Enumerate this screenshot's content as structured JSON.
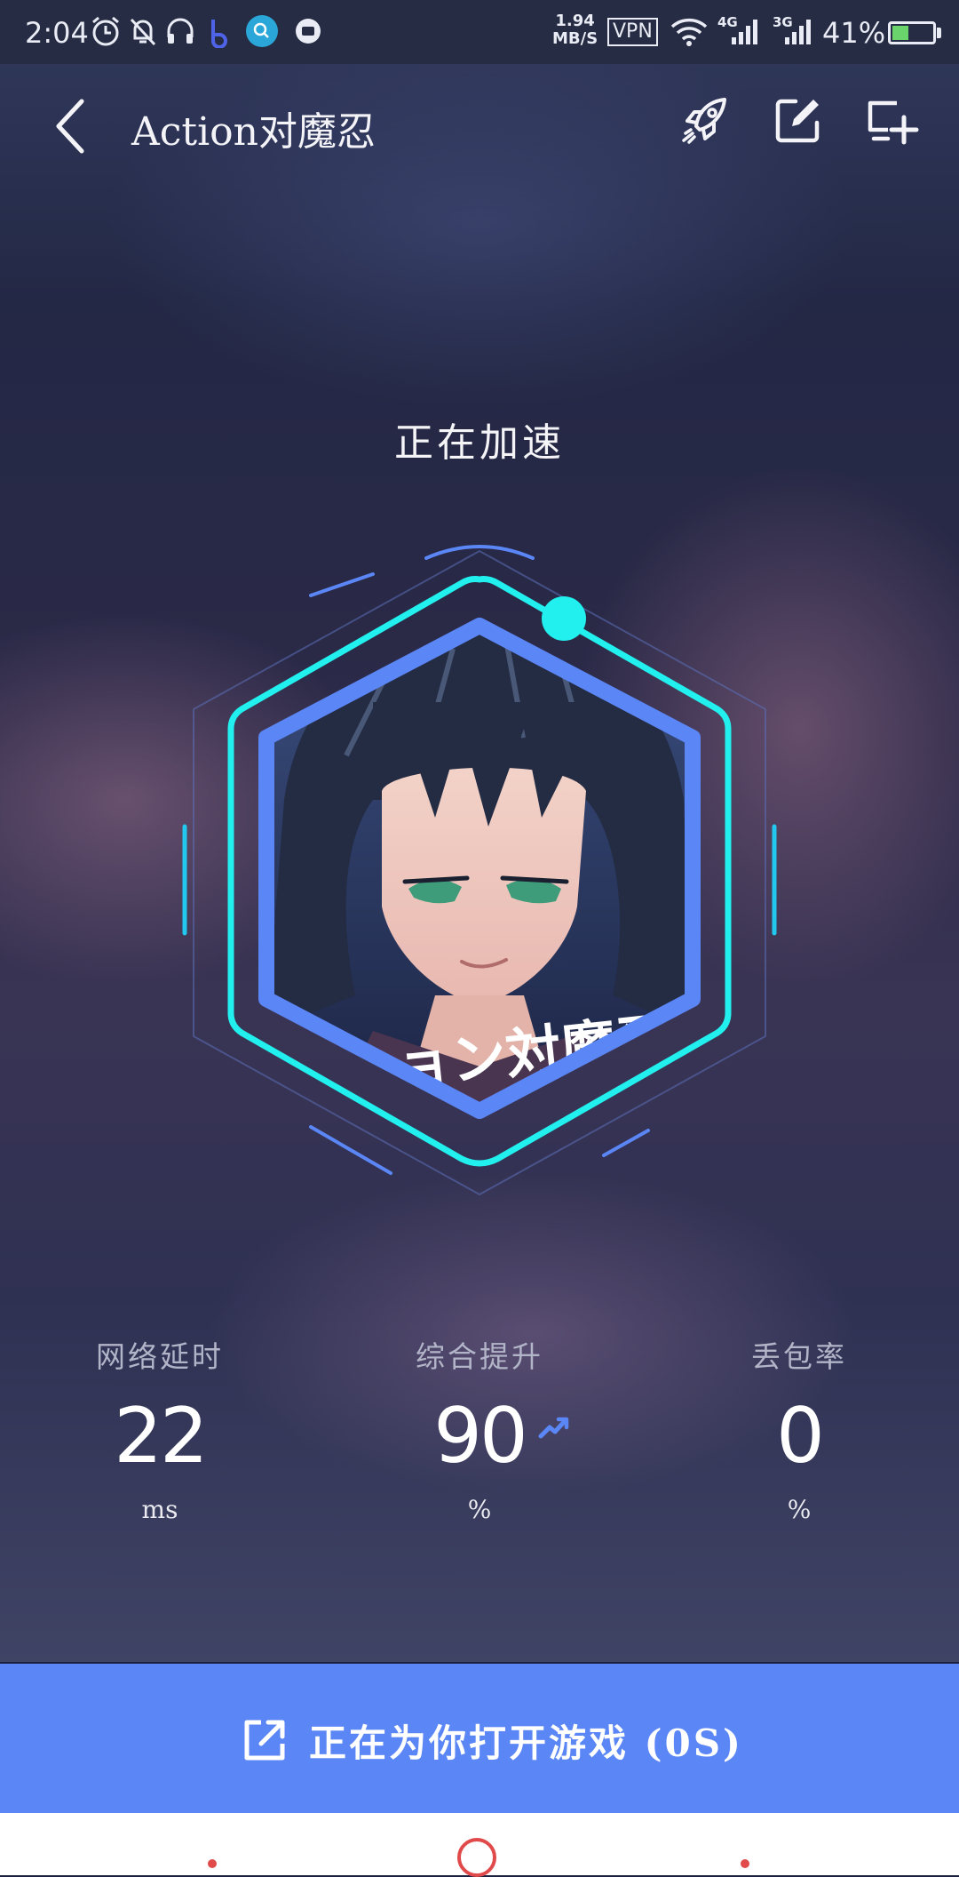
{
  "status_bar": {
    "time": "2:04",
    "net_speed_value": "1.94",
    "net_speed_unit": "MB/S",
    "vpn_label": "VPN",
    "signal1_label": "4G",
    "signal2_label": "3G",
    "battery_percent": "41%",
    "battery_level": 0.41,
    "icons": [
      "alarm-icon",
      "mute-bell-icon",
      "headphones-icon",
      "app-b-icon",
      "search-app-icon",
      "message-app-icon",
      "wifi-icon",
      "signal-icon"
    ]
  },
  "app_bar": {
    "title": "Action对魔忍",
    "actions": [
      "rocket-icon",
      "edit-icon",
      "add-to-desktop-icon"
    ]
  },
  "status_title": "正在加速",
  "stats": [
    {
      "label": "网络延时",
      "value": "22",
      "unit": "ms"
    },
    {
      "label": "综合提升",
      "value": "90",
      "unit": "%"
    },
    {
      "label": "丢包率",
      "value": "0",
      "unit": "%"
    }
  ],
  "game_art_text": "クション対魔忍",
  "open_button": {
    "label": "正在为你打开游戏 (0S)"
  },
  "colors": {
    "accent_blue": "#5b86f6",
    "ring_cyan": "#22f0ee",
    "ring_blue": "#5b86f6"
  }
}
